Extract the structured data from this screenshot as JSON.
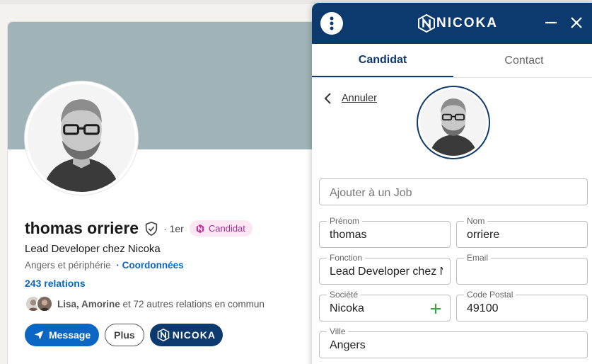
{
  "profile": {
    "name": "thomas orriere",
    "degree": "· 1er",
    "badge": "Candidat",
    "headline": "Lead Developer chez Nicoka",
    "location": "Angers et périphérie",
    "coords_link": "· Coordonnées",
    "relations": "243 relations",
    "mutual_names": "Lisa, Amorine",
    "mutual_rest": " et 72 autres relations en commun",
    "buttons": {
      "message": "Message",
      "plus": "Plus",
      "nicoka": "NICOKA"
    }
  },
  "panel": {
    "brand": "NICOKA",
    "tabs": [
      "Candidat",
      "Contact"
    ],
    "cancel": "Annuler",
    "job_placeholder": "Ajouter à un Job",
    "fields": {
      "prenom": {
        "label": "Prénom",
        "value": "thomas"
      },
      "nom": {
        "label": "Nom",
        "value": "orriere"
      },
      "fonction": {
        "label": "Fonction",
        "value": "Lead Developer chez Nicoka"
      },
      "email": {
        "label": "Email",
        "value": ""
      },
      "societe": {
        "label": "Société",
        "value": "Nicoka"
      },
      "code_postal": {
        "label": "Code Postal",
        "value": "49100"
      },
      "ville": {
        "label": "Ville",
        "value": "Angers"
      }
    }
  },
  "colors": {
    "nicoka_blue": "#0d3a6e",
    "linkedin_blue": "#0a66c2",
    "badge_pink": "#a1338f",
    "add_green": "#2eaa3c"
  }
}
